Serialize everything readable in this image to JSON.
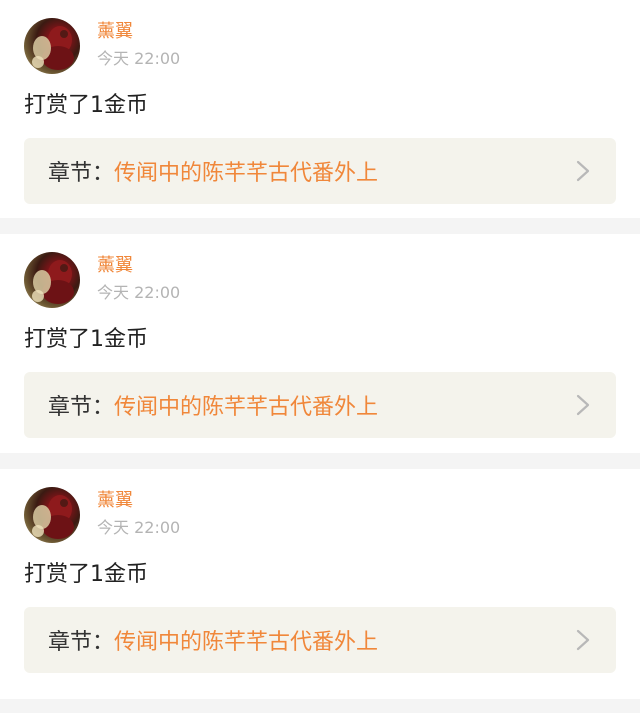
{
  "items": [
    {
      "user": "薰翼",
      "time": "今天 22:00",
      "message": "打赏了1金币",
      "chapter_label": "章节",
      "chapter_colon": "：",
      "chapter_title": "传闻中的陈芊芊古代番外上"
    },
    {
      "user": "薰翼",
      "time": "今天 22:00",
      "message": "打赏了1金币",
      "chapter_label": "章节",
      "chapter_colon": "：",
      "chapter_title": "传闻中的陈芊芊古代番外上"
    },
    {
      "user": "薰翼",
      "time": "今天 22:00",
      "message": "打赏了1金币",
      "chapter_label": "章节",
      "chapter_colon": "：",
      "chapter_title": "传闻中的陈芊芊古代番外上"
    }
  ],
  "colors": {
    "accent": "#f0873a",
    "timestamp": "#b4b4b4",
    "chapter_bg": "#f4f3ec",
    "page_bg": "#f4f4f4"
  },
  "icons": {
    "chevron": "chevron-right-icon",
    "avatar": "avatar"
  }
}
